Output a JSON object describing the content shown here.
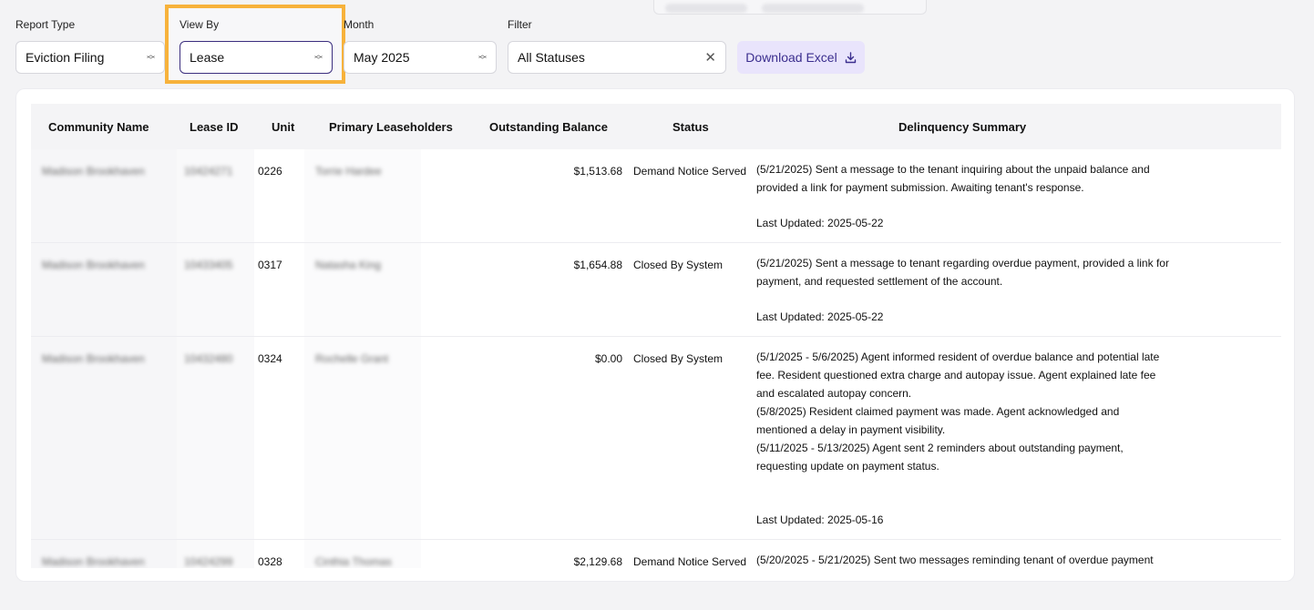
{
  "filters": {
    "report_type": {
      "label": "Report Type",
      "value": "Eviction Filing"
    },
    "view_by": {
      "label": "View By",
      "value": "Lease"
    },
    "month": {
      "label": "Month",
      "value": "May 2025"
    },
    "filter": {
      "label": "Filter",
      "value": "All Statuses"
    },
    "download_label": "Download Excel"
  },
  "table": {
    "headers": [
      "Community Name",
      "Lease ID",
      "Unit",
      "Primary Leaseholders",
      "Outstanding Balance",
      "Status",
      "Delinquency Summary"
    ],
    "rows": [
      {
        "community": "Madison Brookhaven",
        "lease_id": "10424271",
        "unit": "0226",
        "leaseholder": "Torrie Hardee",
        "balance": "$1,513.68",
        "status": "Demand Notice Served",
        "summary": [
          "(5/21/2025) Sent a message to the tenant inquiring about the unpaid balance and",
          "provided a link for payment submission. Awaiting tenant's response."
        ],
        "updated": "Last Updated: 2025-05-22"
      },
      {
        "community": "Madison Brookhaven",
        "lease_id": "10433405",
        "unit": "0317",
        "leaseholder": "Natasha King",
        "balance": "$1,654.88",
        "status": "Closed By System",
        "summary": [
          "(5/21/2025) Sent a message to tenant regarding overdue payment, provided a link for",
          "payment, and requested settlement of the account."
        ],
        "updated": "Last Updated: 2025-05-22"
      },
      {
        "community": "Madison Brookhaven",
        "lease_id": "10432480",
        "unit": "0324",
        "leaseholder": "Rochelle Grant",
        "balance": "$0.00",
        "status": "Closed By System",
        "summary": [
          "(5/1/2025 - 5/6/2025) Agent informed resident of overdue balance and potential late",
          "fee. Resident questioned extra charge and autopay issue. Agent explained late fee",
          "and escalated autopay concern.",
          "(5/8/2025) Resident claimed payment was made. Agent acknowledged and",
          "mentioned a delay in payment visibility.",
          "(5/11/2025 - 5/13/2025) Agent sent 2 reminders about outstanding payment,",
          "requesting update on payment status.",
          ""
        ],
        "updated": "Last Updated: 2025-05-16"
      },
      {
        "community": "Madison Brookhaven",
        "lease_id": "10424299",
        "unit": "0328",
        "leaseholder": "Cinthia Thomas",
        "balance": "$2,129.68",
        "status": "Demand Notice Served",
        "summary": [
          "(5/20/2025 - 5/21/2025) Sent two messages reminding tenant of overdue payment"
        ],
        "updated": ""
      }
    ]
  }
}
